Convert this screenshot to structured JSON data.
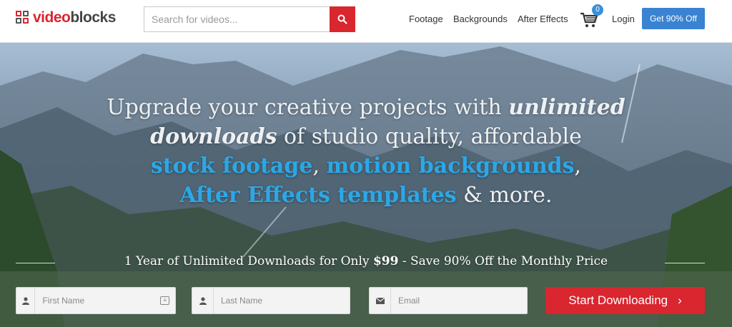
{
  "logo": {
    "part1": "video",
    "part2": "blocks"
  },
  "search": {
    "placeholder": "Search for videos..."
  },
  "nav": {
    "footage": "Footage",
    "backgrounds": "Backgrounds",
    "after_effects": "After Effects",
    "login": "Login"
  },
  "cart": {
    "count": "0"
  },
  "header_cta": "Get 90% Off",
  "hero": {
    "line1_a": "Upgrade your creative projects with ",
    "line1_b": "unlimited",
    "line2_a": "downloads",
    "line2_b": " of studio quality, affordable",
    "line3_a": "stock  footage",
    "line3_b": ", ",
    "line3_c": "motion backgrounds",
    "line3_d": ",",
    "line4_a": "After  Effects templates",
    "line4_b": " & more.",
    "sub_a": "1 Year of Unlimited Downloads for Only ",
    "sub_price": "$99",
    "sub_b": " - Save 90% Off the Monthly Price"
  },
  "form": {
    "first_name": "First Name",
    "last_name": "Last Name",
    "email": "Email",
    "submit": "Start Downloading"
  },
  "colors": {
    "brand_red": "#d9262f",
    "accent_blue": "#2aa8e8",
    "cta_blue": "#3a82d2"
  }
}
